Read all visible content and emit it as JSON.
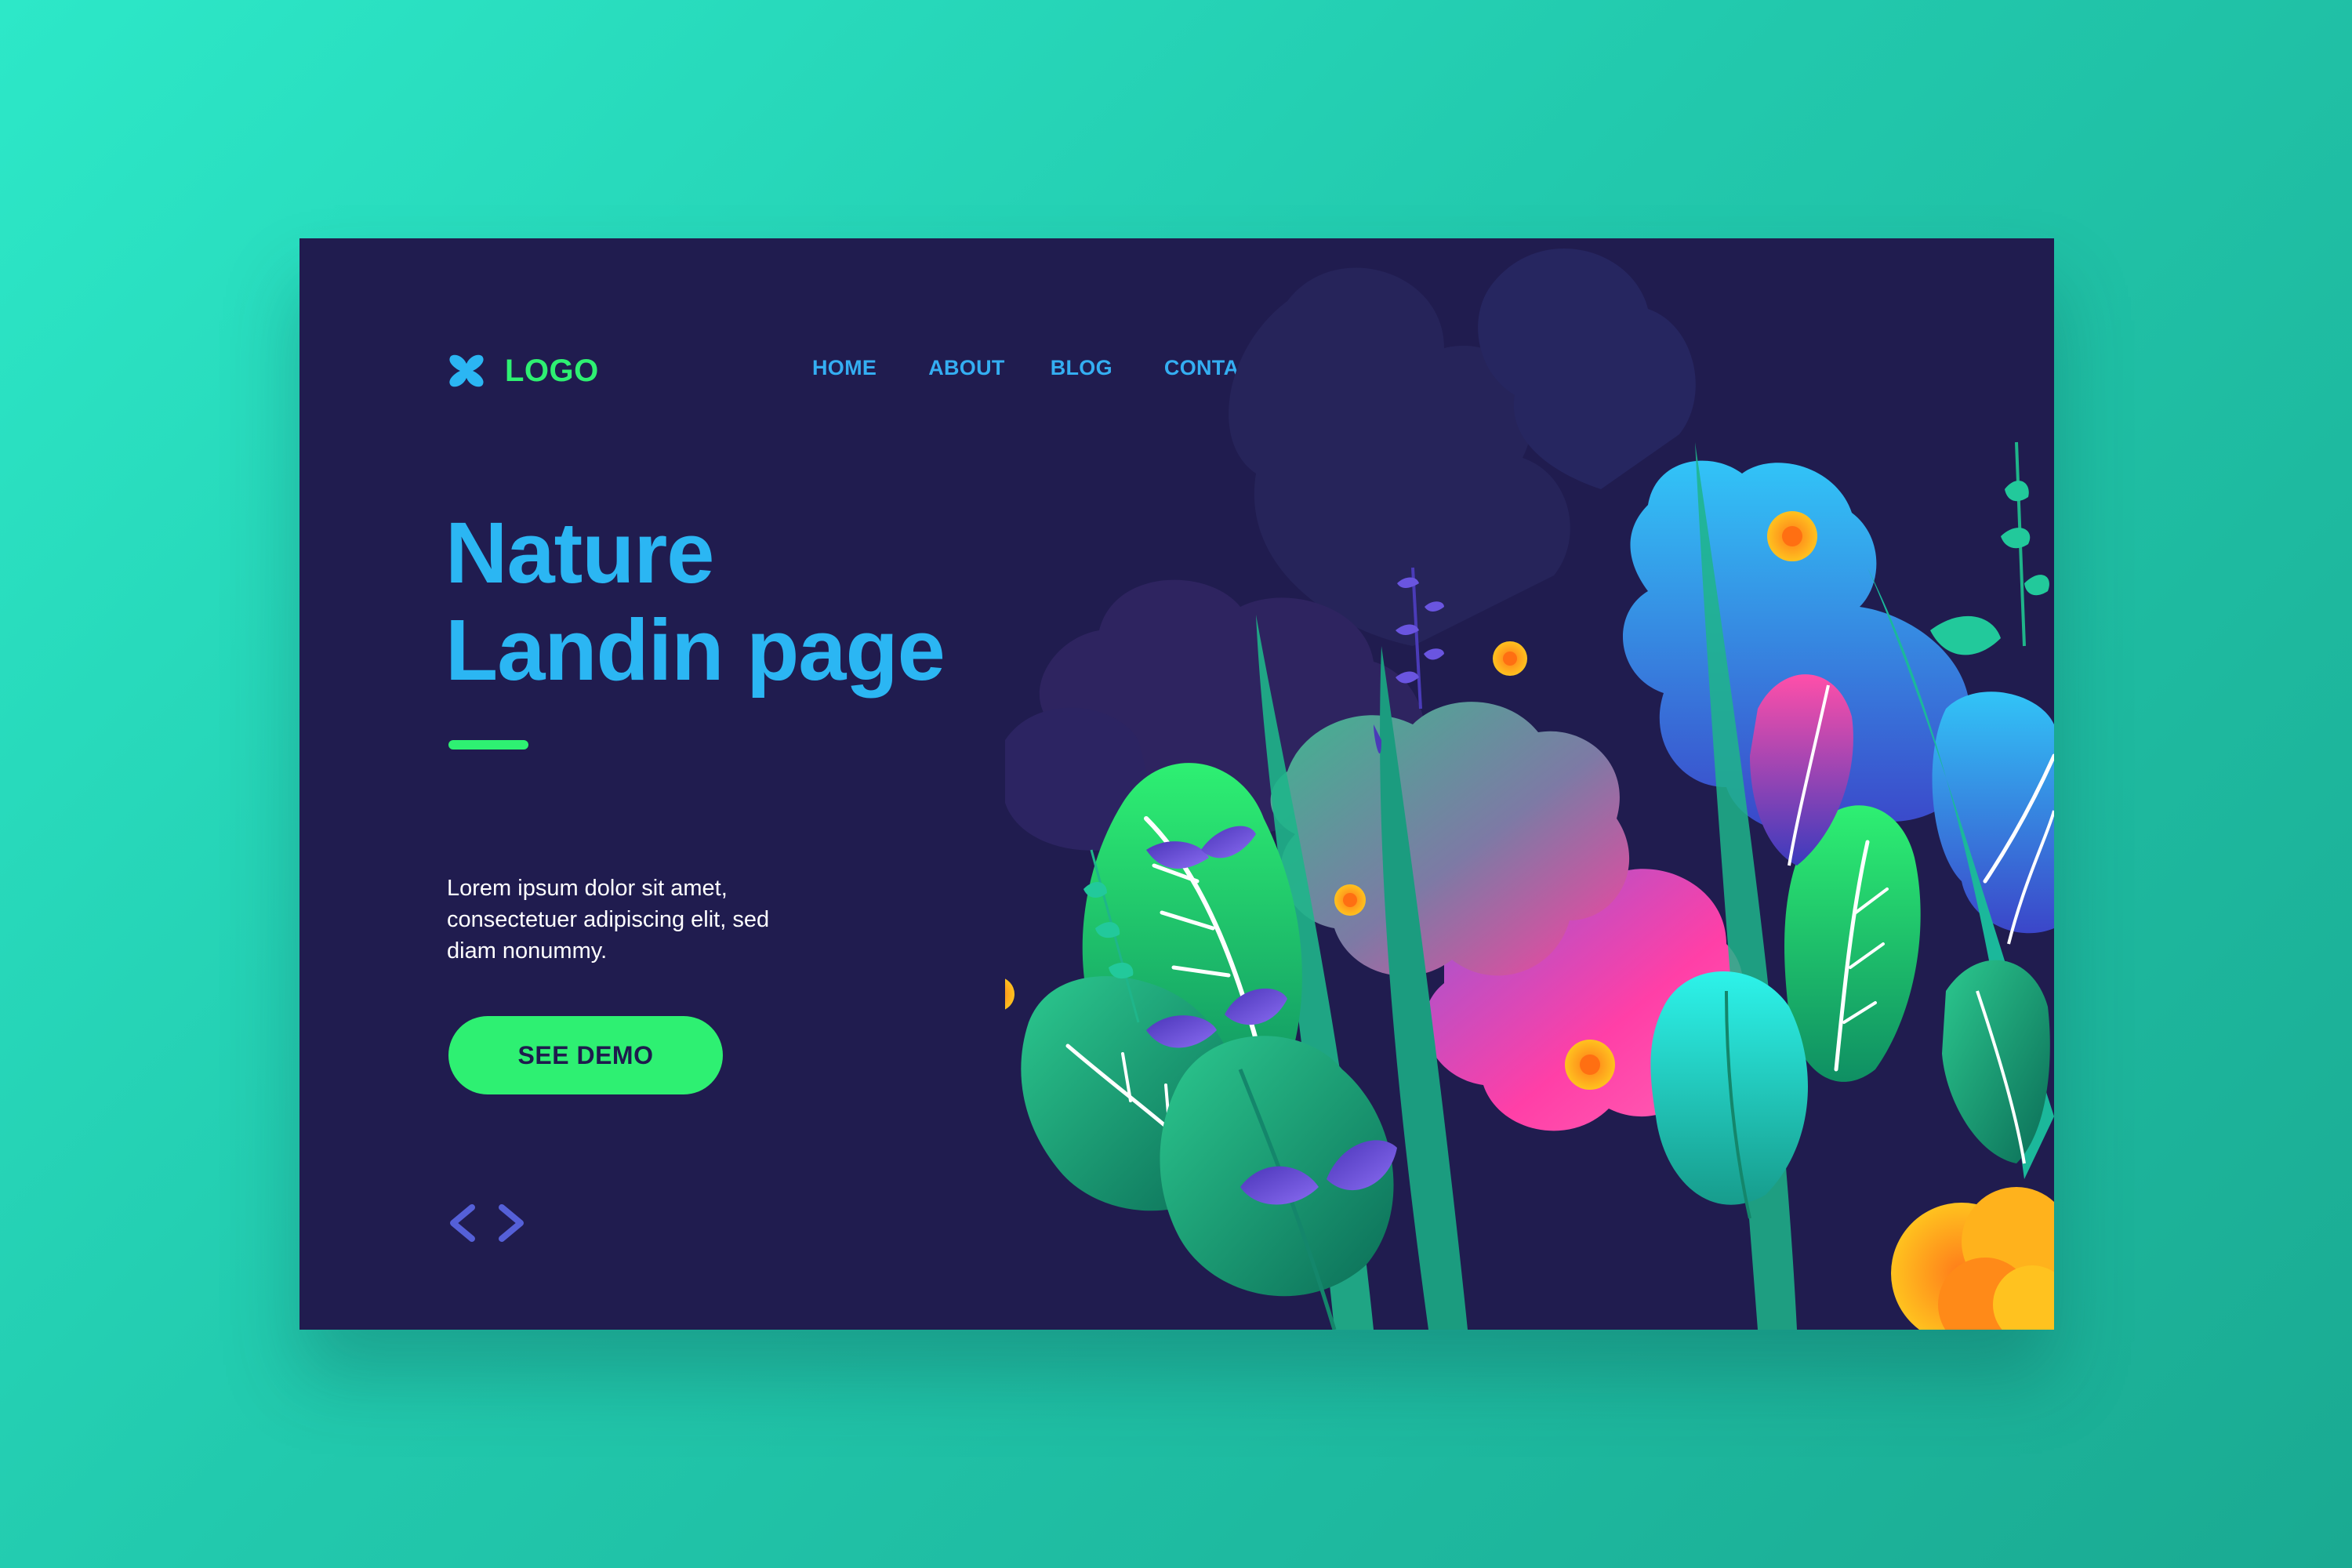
{
  "header": {
    "logo_text": "LOGO",
    "nav": [
      {
        "label": "HOME"
      },
      {
        "label": "ABOUT"
      },
      {
        "label": "BLOG"
      },
      {
        "label": "CONTACT"
      }
    ]
  },
  "hero": {
    "title_line1": "Nature",
    "title_line2": "Landin page",
    "description_lines": [
      "Lorem ipsum dolor sit amet,",
      "consectetuer adipiscing elit, sed",
      "diam nonummy."
    ],
    "cta_label": "SEE DEMO"
  },
  "icons": {
    "logo": "four-petal-logo-icon",
    "prev": "chevron-left-icon",
    "next": "chevron-right-icon"
  },
  "colors": {
    "page_background": "#22c9ad",
    "card_background": "#201c4f",
    "title": "#2bb6f3",
    "nav": "#34aef2",
    "accent_green": "#2ef072",
    "arrows": "#5560d8"
  }
}
